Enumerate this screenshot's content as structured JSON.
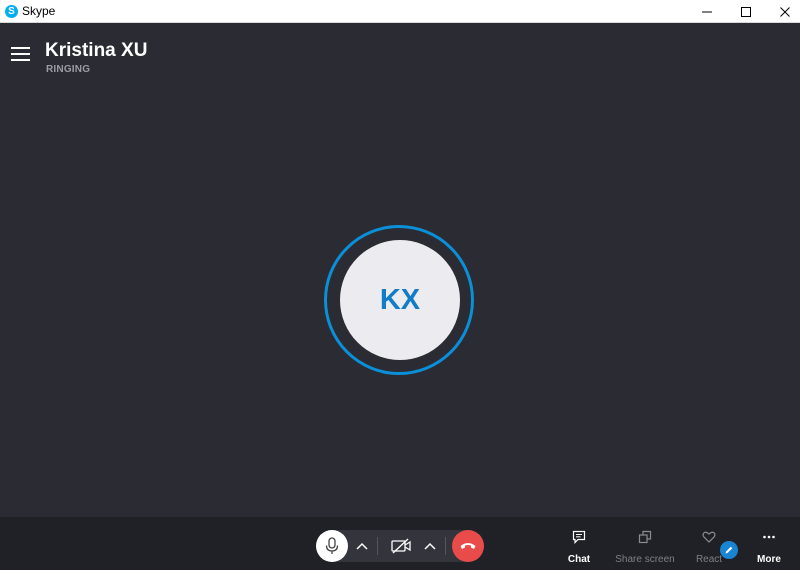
{
  "window": {
    "app_title": "Skype",
    "app_logo_letter": "S",
    "controls": [
      "minimize-icon",
      "maximize-icon",
      "close-icon"
    ]
  },
  "call": {
    "contact_name": "Kristina XU",
    "status": "RINGING",
    "avatar_initials": "KX"
  },
  "controls": {
    "microphone": {
      "icon": "microphone-icon",
      "state": "on"
    },
    "mic_options": {
      "icon": "chevron-up-icon"
    },
    "video": {
      "icon": "video-off-icon",
      "state": "off"
    },
    "video_options": {
      "icon": "chevron-up-icon"
    },
    "hang_up": {
      "icon": "phone-hangup-icon"
    }
  },
  "actions": [
    {
      "label": "Chat",
      "icon": "chat-icon",
      "active": true
    },
    {
      "label": "Share screen",
      "icon": "share-screen-icon",
      "active": false
    },
    {
      "label": "React",
      "icon": "heart-icon",
      "active": false
    },
    {
      "label": "More",
      "icon": "more-dots-icon",
      "active": true
    }
  ],
  "colors": {
    "background": "#2b2c33",
    "control_bar": "#202126",
    "accent_ring": "#0a8fd8",
    "initials": "#117dc7",
    "hang_up": "#e94a4a",
    "skype_brand": "#00aff0"
  }
}
